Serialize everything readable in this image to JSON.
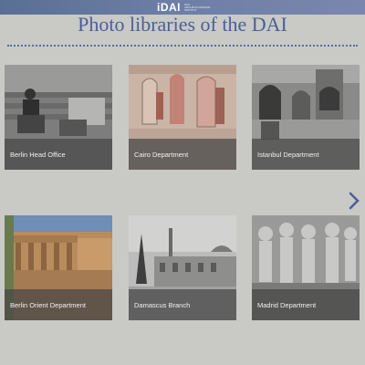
{
  "header": {
    "logo": "iDAI",
    "logo_subtitle": "DAS ARCHÄOLOGISCHE INSTITUT",
    "title": "Photo libraries of the DAI"
  },
  "tiles": [
    {
      "label": "Berlin Head Office"
    },
    {
      "label": "Cairo Department"
    },
    {
      "label": "Istanbul Department"
    },
    {
      "label": "Berlin Orient Department"
    },
    {
      "label": "Damascus Branch"
    },
    {
      "label": "Madrid Department"
    }
  ],
  "navigation": {
    "next_icon": "chevron-right-icon"
  },
  "colors": {
    "accent": "#4a5f9a",
    "header_bar": "#6e7fa6",
    "background": "#c9c9c6"
  }
}
